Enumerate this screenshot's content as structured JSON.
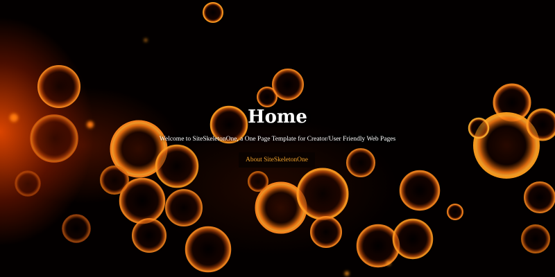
{
  "hero": {
    "title": "Home",
    "tagline": "Welcome to SiteSkeletonOne, a One Page Template for Creator/User Friendly Web Pages",
    "cta_label": "About SiteSkeletonOne"
  },
  "colors": {
    "background": "#000000",
    "bubble_glow": "#ff7a10",
    "title_text": "#ffffff",
    "cta_text": "#f0a12a",
    "cta_background": "#080200"
  }
}
